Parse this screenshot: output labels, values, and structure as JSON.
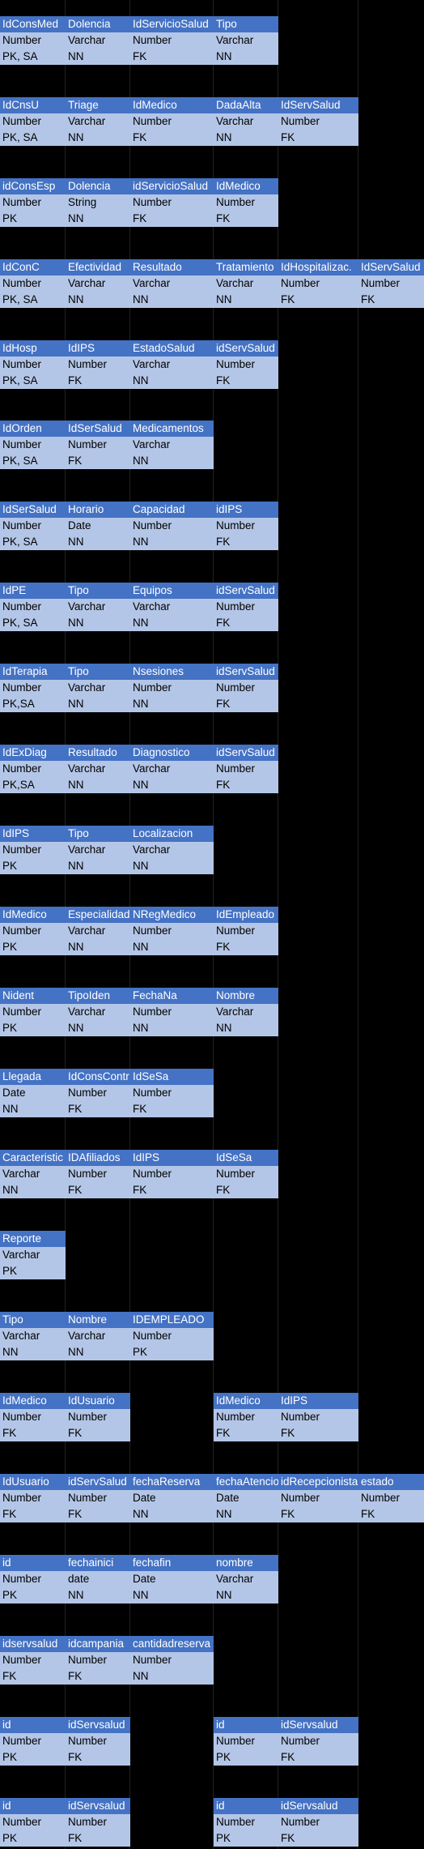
{
  "sheet": {
    "header_color": "#4472C4",
    "row_color": "#B4C6E7",
    "grid_color": "#222222",
    "background": "#000000"
  },
  "tables": [
    {
      "left": [
        {
          "h": "IdConsMed",
          "t": "Number",
          "k": "PK, SA"
        },
        {
          "h": "Dolencia",
          "t": "Varchar",
          "k": "NN"
        },
        {
          "h": "IdServicioSalud",
          "t": "Number",
          "k": "FK"
        },
        {
          "h": "Tipo",
          "t": "Varchar",
          "k": "NN"
        }
      ]
    },
    {
      "left": [
        {
          "h": "IdCnsU",
          "t": "Number",
          "k": "PK, SA"
        },
        {
          "h": "Triage",
          "t": "Varchar",
          "k": "NN"
        },
        {
          "h": "IdMedico",
          "t": "Number",
          "k": "FK"
        },
        {
          "h": "DadaAlta",
          "t": "Varchar",
          "k": "NN"
        },
        {
          "h": "IdServSalud",
          "t": "Number",
          "k": "FK"
        }
      ]
    },
    {
      "left": [
        {
          "h": "idConsEsp",
          "t": "Number",
          "k": "PK"
        },
        {
          "h": "Dolencia",
          "t": "String",
          "k": "NN"
        },
        {
          "h": "idServicioSalud",
          "t": "Number",
          "k": "FK"
        },
        {
          "h": "IdMedico",
          "t": "Number",
          "k": "FK"
        }
      ]
    },
    {
      "left": [
        {
          "h": "IdConC",
          "t": "Number",
          "k": "PK, SA"
        },
        {
          "h": "Efectividad",
          "t": "Varchar",
          "k": "NN"
        },
        {
          "h": "Resultado",
          "t": "Varchar",
          "k": "NN"
        },
        {
          "h": "Tratamiento",
          "t": "Varchar",
          "k": "NN"
        },
        {
          "h": "IdHospitalizac.",
          "t": "Number",
          "k": "FK"
        },
        {
          "h": "IdServSalud",
          "t": "Number",
          "k": "FK"
        }
      ]
    },
    {
      "left": [
        {
          "h": "IdHosp",
          "t": "Number",
          "k": "PK, SA"
        },
        {
          "h": "IdIPS",
          "t": "Number",
          "k": "FK"
        },
        {
          "h": "EstadoSalud",
          "t": "Varchar",
          "k": "NN"
        },
        {
          "h": "idServSalud",
          "t": "Number",
          "k": "FK"
        }
      ]
    },
    {
      "left": [
        {
          "h": "IdOrden",
          "t": "Number",
          "k": "PK, SA"
        },
        {
          "h": "IdSerSalud",
          "t": "Number",
          "k": "FK"
        },
        {
          "h": "Medicamentos",
          "t": "Varchar",
          "k": "NN"
        }
      ]
    },
    {
      "left": [
        {
          "h": "IdSerSalud",
          "t": "Number",
          "k": "PK, SA"
        },
        {
          "h": "Horario",
          "t": "Date",
          "k": "NN"
        },
        {
          "h": "Capacidad",
          "t": "Number",
          "k": "NN"
        },
        {
          "h": "idIPS",
          "t": "Number",
          "k": "FK"
        }
      ]
    },
    {
      "left": [
        {
          "h": "IdPE",
          "t": "Number",
          "k": "PK, SA"
        },
        {
          "h": "Tipo",
          "t": "Varchar",
          "k": "NN"
        },
        {
          "h": "Equipos",
          "t": "Varchar",
          "k": "NN"
        },
        {
          "h": "idServSalud",
          "t": "Number",
          "k": "FK"
        }
      ]
    },
    {
      "left": [
        {
          "h": "IdTerapia",
          "t": "Number",
          "k": "PK,SA"
        },
        {
          "h": "Tipo",
          "t": "Varchar",
          "k": "NN"
        },
        {
          "h": "Nsesiones",
          "t": "Number",
          "k": "NN"
        },
        {
          "h": "idServSalud",
          "t": "Number",
          "k": "FK"
        }
      ]
    },
    {
      "left": [
        {
          "h": "IdExDiag",
          "t": "Number",
          "k": "PK,SA"
        },
        {
          "h": "Resultado",
          "t": "Varchar",
          "k": "NN"
        },
        {
          "h": "Diagnostico",
          "t": "Varchar",
          "k": "NN"
        },
        {
          "h": "idServSalud",
          "t": "Number",
          "k": "FK"
        }
      ]
    },
    {
      "left": [
        {
          "h": "IdIPS",
          "t": "Number",
          "k": "PK"
        },
        {
          "h": "Tipo",
          "t": "Varchar",
          "k": "NN"
        },
        {
          "h": "Localizacion",
          "t": "Varchar",
          "k": "NN"
        }
      ]
    },
    {
      "left": [
        {
          "h": "IdMedico",
          "t": "Number",
          "k": "PK"
        },
        {
          "h": "Especialidad",
          "t": "Varchar",
          "k": "NN"
        },
        {
          "h": "NRegMedico",
          "t": "Number",
          "k": "NN"
        },
        {
          "h": "IdEmpleado",
          "t": "Number",
          "k": "FK"
        }
      ]
    },
    {
      "left": [
        {
          "h": "Nident",
          "t": "Number",
          "k": "PK"
        },
        {
          "h": "TipoIden",
          "t": "Varchar",
          "k": "NN"
        },
        {
          "h": "FechaNa",
          "t": "Number",
          "k": "NN"
        },
        {
          "h": "Nombre",
          "t": "Varchar",
          "k": "NN"
        }
      ]
    },
    {
      "left": [
        {
          "h": "Llegada",
          "t": "Date",
          "k": "NN"
        },
        {
          "h": "IdConsContr",
          "t": "Number",
          "k": "FK"
        },
        {
          "h": "IdSeSa",
          "t": "Number",
          "k": "FK"
        }
      ]
    },
    {
      "left": [
        {
          "h": "Caracteristic",
          "t": "Varchar",
          "k": "NN"
        },
        {
          "h": "IDAfiliados",
          "t": "Number",
          "k": "FK"
        },
        {
          "h": "IdIPS",
          "t": "Number",
          "k": "FK"
        },
        {
          "h": "IdSeSa",
          "t": "Number",
          "k": "FK"
        }
      ]
    },
    {
      "left": [
        {
          "h": "Reporte",
          "t": "Varchar",
          "k": "PK"
        }
      ]
    },
    {
      "left": [
        {
          "h": "Tipo",
          "t": "Varchar",
          "k": "NN"
        },
        {
          "h": "Nombre",
          "t": "Varchar",
          "k": "NN"
        },
        {
          "h": "IDEMPLEADO",
          "t": "Number",
          "k": "PK"
        }
      ]
    },
    {
      "left": [
        {
          "h": "IdMedico",
          "t": "Number",
          "k": "FK"
        },
        {
          "h": "IdUsuario",
          "t": "Number",
          "k": "FK"
        }
      ],
      "right": [
        {
          "h": "IdMedico",
          "t": "Number",
          "k": "FK"
        },
        {
          "h": "IdIPS",
          "t": "Number",
          "k": "FK"
        }
      ]
    },
    {
      "left": [
        {
          "h": "IdUsuario",
          "t": "Number",
          "k": "FK"
        },
        {
          "h": "idServSalud",
          "t": "Number",
          "k": "FK"
        },
        {
          "h": "fechaReserva",
          "t": "Date",
          "k": "NN"
        },
        {
          "h": "fechaAtencion",
          "t": "Date",
          "k": "NN"
        },
        {
          "h": "idRecepcionista",
          "t": "Number",
          "k": "FK"
        },
        {
          "h": "estado",
          "t": "Number",
          "k": "FK"
        }
      ]
    },
    {
      "left": [
        {
          "h": "id",
          "t": "Number",
          "k": "PK"
        },
        {
          "h": "fechainici",
          "t": "date",
          "k": "NN"
        },
        {
          "h": "fechafin",
          "t": "Date",
          "k": "NN"
        },
        {
          "h": "nombre",
          "t": "Varchar",
          "k": "NN"
        }
      ]
    },
    {
      "left": [
        {
          "h": "idservsalud",
          "t": "Number",
          "k": "FK"
        },
        {
          "h": "idcampania",
          "t": "Number",
          "k": "FK"
        },
        {
          "h": "cantidadreserva",
          "t": "Number",
          "k": "NN"
        }
      ]
    },
    {
      "left": [
        {
          "h": "id",
          "t": "Number",
          "k": "PK"
        },
        {
          "h": "idServsalud",
          "t": "Number",
          "k": "FK"
        }
      ],
      "right": [
        {
          "h": "id",
          "t": "Number",
          "k": "PK"
        },
        {
          "h": "idServsalud",
          "t": "Number",
          "k": "FK"
        }
      ]
    },
    {
      "left": [
        {
          "h": "id",
          "t": "Number",
          "k": "PK"
        },
        {
          "h": "idServsalud",
          "t": "Number",
          "k": "FK"
        }
      ],
      "right": [
        {
          "h": "id",
          "t": "Number",
          "k": "PK"
        },
        {
          "h": "idServsalud",
          "t": "Number",
          "k": "FK"
        }
      ]
    }
  ]
}
